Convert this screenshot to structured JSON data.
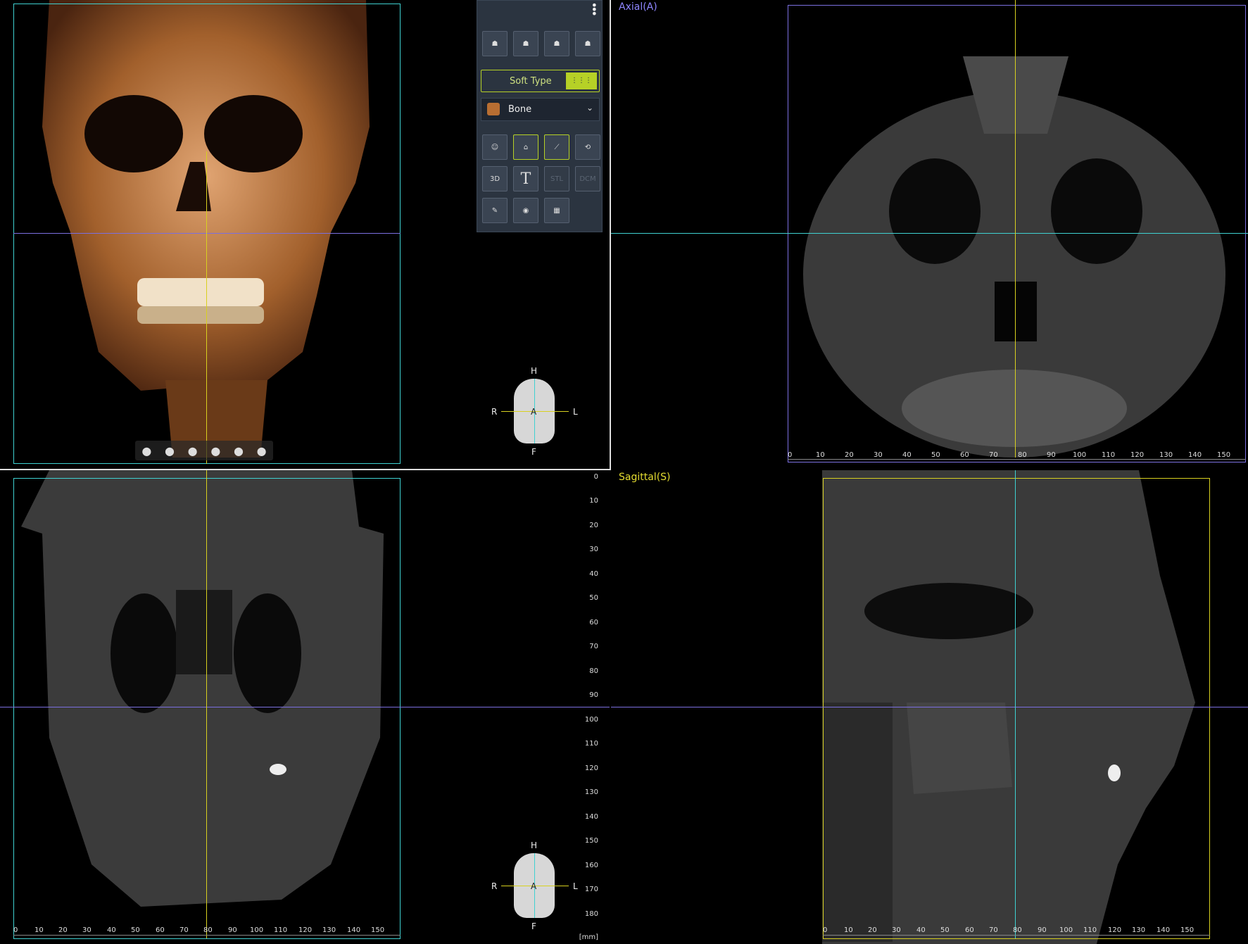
{
  "views": {
    "axial_label": "Axial(A)",
    "sagittal_label": "Sagittal(S)"
  },
  "toolbar": {
    "menu_icon": "vertical-dots-icon",
    "view_buttons": [
      "view-front-icon",
      "view-top-icon",
      "view-side-left-icon",
      "view-side-right-icon"
    ],
    "soft_type_label": "Soft Type",
    "preset_selected": "Bone",
    "tool_row1": [
      "face-scan-icon",
      "patient-scan-icon",
      "implant-icon",
      "3d-rotate-icon"
    ],
    "tool_row2_labels": [
      "3D",
      "T",
      "STL",
      "DCM"
    ],
    "tool_row3": [
      "sculpt-icon",
      "tooth-view-icon",
      "grid-icon"
    ]
  },
  "ruler": {
    "h_ticks": [
      "0",
      "10",
      "20",
      "30",
      "40",
      "50",
      "60",
      "70",
      "80",
      "90",
      "100",
      "110",
      "120",
      "130",
      "140",
      "150"
    ],
    "v_ticks": [
      "0",
      "10",
      "20",
      "30",
      "40",
      "50",
      "60",
      "70",
      "80",
      "90",
      "100",
      "110",
      "120",
      "130",
      "140",
      "150",
      "160",
      "170",
      "180"
    ],
    "unit": "[mm]"
  },
  "orientation": {
    "top": "H",
    "bottom": "F",
    "left": "R",
    "right": "L",
    "center": "A"
  },
  "colors": {
    "accent": "#b6d126",
    "cyan": "#3fd1d1",
    "purple": "#7b6fe0",
    "yellow": "#d8d020",
    "panel": "#2b3440"
  }
}
